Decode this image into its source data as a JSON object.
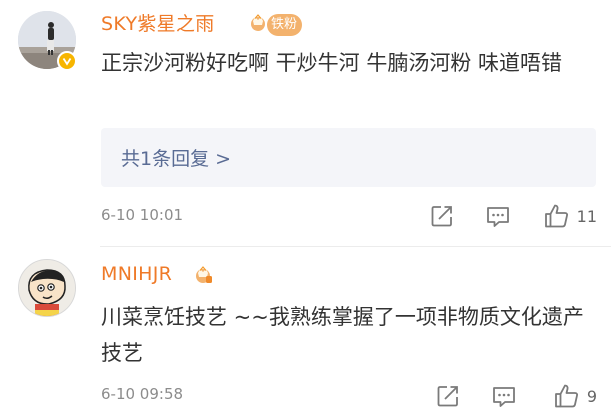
{
  "comments": [
    {
      "username": "SKY紫星之雨",
      "fan_badge": "铁粉",
      "text": "正宗沙河粉好吃啊 干炒牛河 牛腩汤河粉 味道唔错",
      "replies_link": "共1条回复 >",
      "time": "6-10 10:01",
      "like_count": "11"
    },
    {
      "username": "MNIHJR",
      "text": "川菜烹饪技艺 ~~我熟练掌握了一项非物质文化遗产技艺",
      "time": "6-10 09:58",
      "like_count": "9"
    }
  ],
  "icons": {
    "share": "share-icon",
    "comment": "comment-icon",
    "like": "like-icon",
    "verified": "verified-badge-icon",
    "crown": "crown-icon"
  },
  "colors": {
    "username": "#ef7a28",
    "link": "#596b94",
    "reply_box": "#f4f5f9",
    "fan_badge": "#f3b26d"
  }
}
